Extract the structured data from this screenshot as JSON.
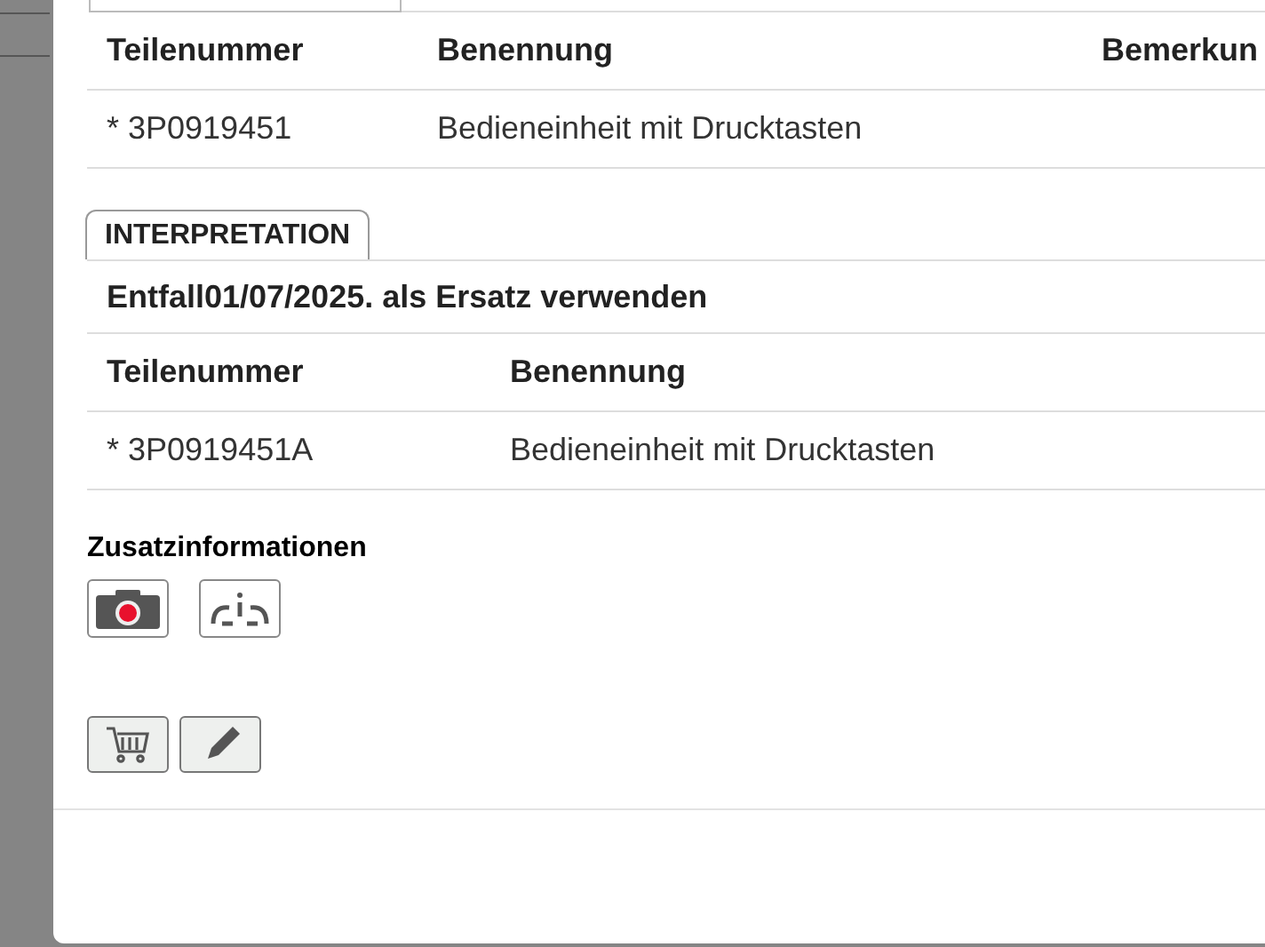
{
  "parts_table": {
    "columns": [
      "Teilenummer",
      "Benennung",
      "Bemerkun"
    ],
    "rows": [
      [
        "* 3P0919451",
        "Bedieneinheit mit Drucktasten"
      ]
    ]
  },
  "interpretation": {
    "tab": "INTERPRETATION",
    "note": "Entfall01/07/2025. als Ersatz verwenden",
    "columns": [
      "Teilenummer",
      "Benennung"
    ],
    "rows": [
      [
        "* 3P0919451A",
        "Bedieneinheit mit Drucktasten"
      ]
    ]
  },
  "additional_info": {
    "title": "Zusatzinformationen",
    "buttons": [
      {
        "kind": "camera"
      },
      {
        "kind": "info"
      }
    ]
  },
  "actions": [
    {
      "kind": "cart"
    },
    {
      "kind": "pencil"
    }
  ]
}
